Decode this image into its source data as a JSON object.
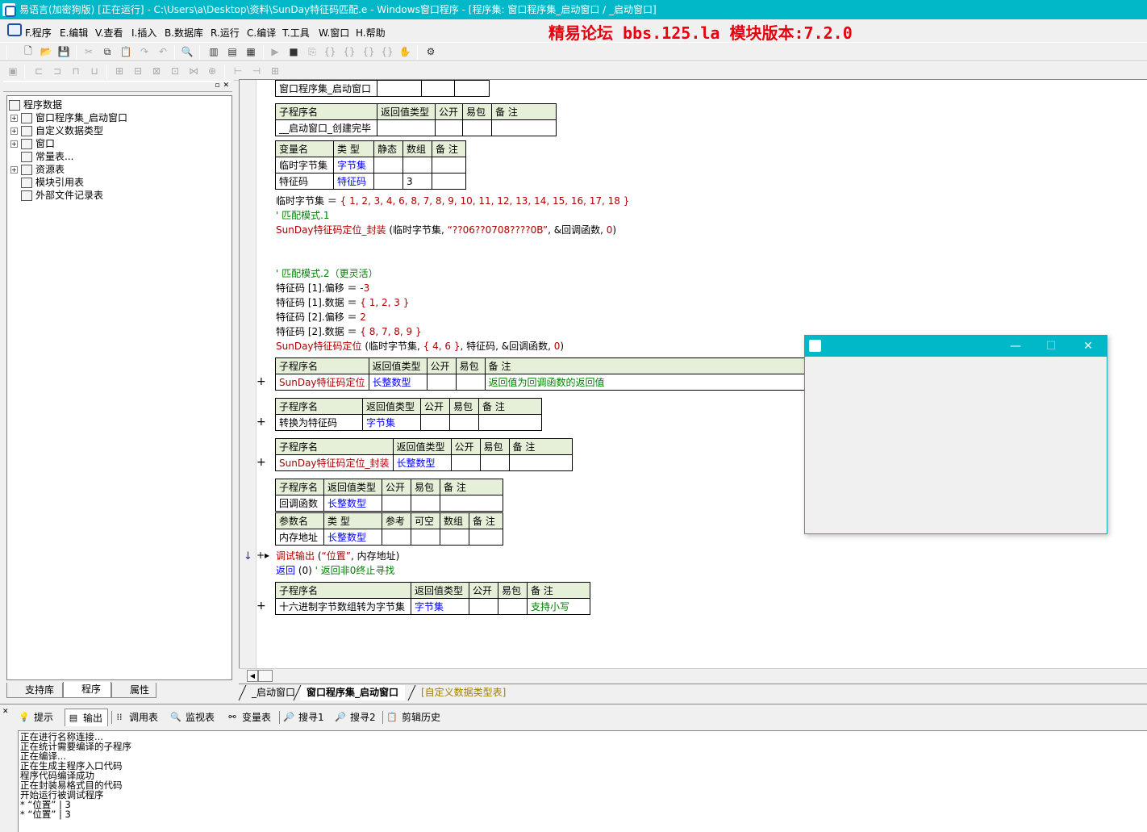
{
  "window": {
    "title": "易语言(加密狗版) [正在运行] - C:\\Users\\a\\Desktop\\资料\\SunDay特征码匹配.e - Windows窗口程序 - [程序集: 窗口程序集_启动窗口 / _启动窗口]"
  },
  "menu": {
    "items": [
      "F.程序",
      "E.编辑",
      "V.查看",
      "I.插入",
      "B.数据库",
      "R.运行",
      "C.编译",
      "T.工具",
      "W.窗口",
      "H.帮助"
    ],
    "banner": "精易论坛 bbs.125.la 模块版本:7.2.0"
  },
  "left_panel": {
    "tree": {
      "root": "程序数据",
      "items": [
        "窗口程序集_启动窗口",
        "自定义数据类型",
        "窗口",
        "常量表...",
        "资源表",
        "模块引用表",
        "外部文件记录表"
      ]
    },
    "tabs": [
      "支持库",
      "程序",
      "属性"
    ]
  },
  "editor": {
    "assembly_table": {
      "name": "窗口程序集_启动窗口"
    },
    "sub1": {
      "headers": [
        "子程序名",
        "返回值类型",
        "公开",
        "易包",
        "备 注"
      ],
      "name": "__启动窗口_创建完毕",
      "var_headers": [
        "变量名",
        "类 型",
        "静态",
        "数组",
        "备 注"
      ],
      "vars": [
        {
          "name": "临时字节集",
          "type": "字节集",
          "array": ""
        },
        {
          "name": "特征码",
          "type": "特征码",
          "array": "3"
        }
      ]
    },
    "code_lines": {
      "l1_a": "临时字节集 ＝ ",
      "l1_b": "{ 1, 2, 3, 4, 6, 8, 7, 8, 9, 10, 11, 12, 13, 14, 15, 16, 17, 18 }",
      "l2": "' 匹配模式.1",
      "l3_a": "SunDay特征码定位_封装",
      "l3_b": " (临时字节集, ",
      "l3_c": "“??06??0708????0B”",
      "l3_d": ", &回调函数, ",
      "l3_e": "0",
      "l3_f": ")",
      "l4": "' 匹配模式.2（更灵活）",
      "l5_a": "特征码 [1].偏移 ＝ ",
      "l5_b": "-3",
      "l6_a": "特征码 [1].数据 ＝ ",
      "l6_b": "{ 1, 2, 3 }",
      "l7_a": "特征码 [2].偏移 ＝ ",
      "l7_b": "2",
      "l8_a": "特征码 [2].数据 ＝ ",
      "l8_b": "{ 8, 7, 8, 9 }",
      "l9_a": "SunDay特征码定位",
      "l9_b": " (临时字节集, ",
      "l9_c": "{ 4, 6 }",
      "l9_d": ", 特征码, &回调函数, ",
      "l9_e": "0",
      "l9_f": ")",
      "l10_a": "调试输出",
      "l10_b": " (",
      "l10_c": "“位置”",
      "l10_d": ", 内存地址)",
      "l11_a": "返回",
      "l11_b": " (0)  ",
      "l11_c": "' 返回非0终止寻找"
    },
    "sub2": {
      "headers": [
        "子程序名",
        "返回值类型",
        "公开",
        "易包",
        "备 注"
      ],
      "name": "SunDay特征码定位",
      "ret": "长整数型",
      "note": "返回值为回调函数的返回值"
    },
    "sub3": {
      "headers": [
        "子程序名",
        "返回值类型",
        "公开",
        "易包",
        "备 注"
      ],
      "name": "转换为特征码",
      "ret": "字节集"
    },
    "sub4": {
      "headers": [
        "子程序名",
        "返回值类型",
        "公开",
        "易包",
        "备 注"
      ],
      "name": "SunDay特征码定位_封装",
      "ret": "长整数型"
    },
    "sub5": {
      "headers": [
        "子程序名",
        "返回值类型",
        "公开",
        "易包",
        "备 注"
      ],
      "name": "回调函数",
      "ret": "长整数型",
      "param_headers": [
        "参数名",
        "类 型",
        "参考",
        "可空",
        "数组",
        "备 注"
      ],
      "param": {
        "name": "内存地址",
        "type": "长整数型"
      }
    },
    "sub6": {
      "headers": [
        "子程序名",
        "返回值类型",
        "公开",
        "易包",
        "备 注"
      ],
      "name": "十六进制字节数组转为字节集",
      "ret": "字节集",
      "note": "支持小写"
    },
    "tabs": [
      "_启动窗口",
      "窗口程序集_启动窗口",
      "[自定义数据类型表]"
    ]
  },
  "bottom_panel": {
    "tabs": [
      "提示",
      "输出",
      "调用表",
      "监视表",
      "变量表",
      "搜寻1",
      "搜寻2",
      "剪辑历史"
    ],
    "output_lines": [
      "正在进行名称连接...",
      "正在统计需要编译的子程序",
      "正在编译...",
      "正在生成主程序入口代码",
      "程序代码编译成功",
      "正在封装易格式目的代码",
      "开始运行被调试程序",
      "* “位置” | 3",
      "* “位置” | 3"
    ]
  }
}
